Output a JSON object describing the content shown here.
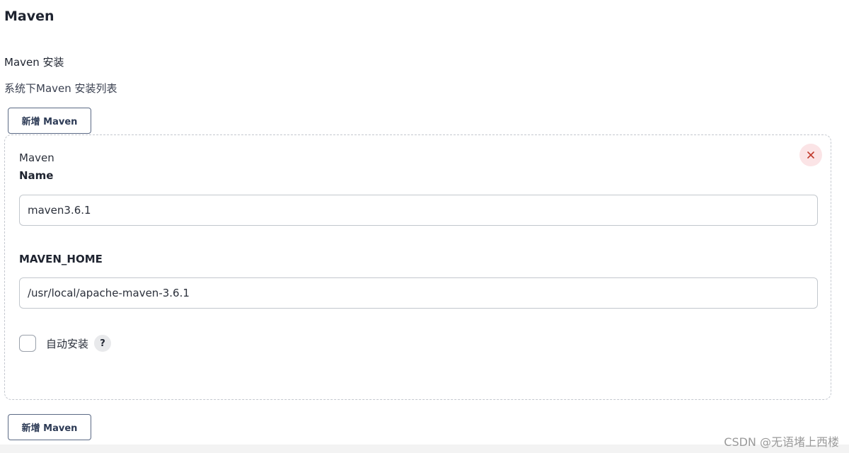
{
  "section": {
    "title": "Maven",
    "installations_label": "Maven 安装",
    "description": "系统下Maven 安装列表"
  },
  "buttons": {
    "add_maven_label": "新增 Maven"
  },
  "installation": {
    "header": "Maven",
    "delete_icon": "close-icon",
    "name_label": "Name",
    "name_value": "maven3.6.1",
    "home_label": "MAVEN_HOME",
    "home_value": "/usr/local/apache-maven-3.6.1",
    "auto_install_label": "自动安装",
    "auto_install_checked": false,
    "help_symbol": "?"
  },
  "watermark": "CSDN @无语堵上西楼",
  "colors": {
    "delete_bg": "#fbe4e6",
    "delete_icon": "#c0392b",
    "button_border": "#5b6a85",
    "dashed_border": "#c4c8cf"
  }
}
